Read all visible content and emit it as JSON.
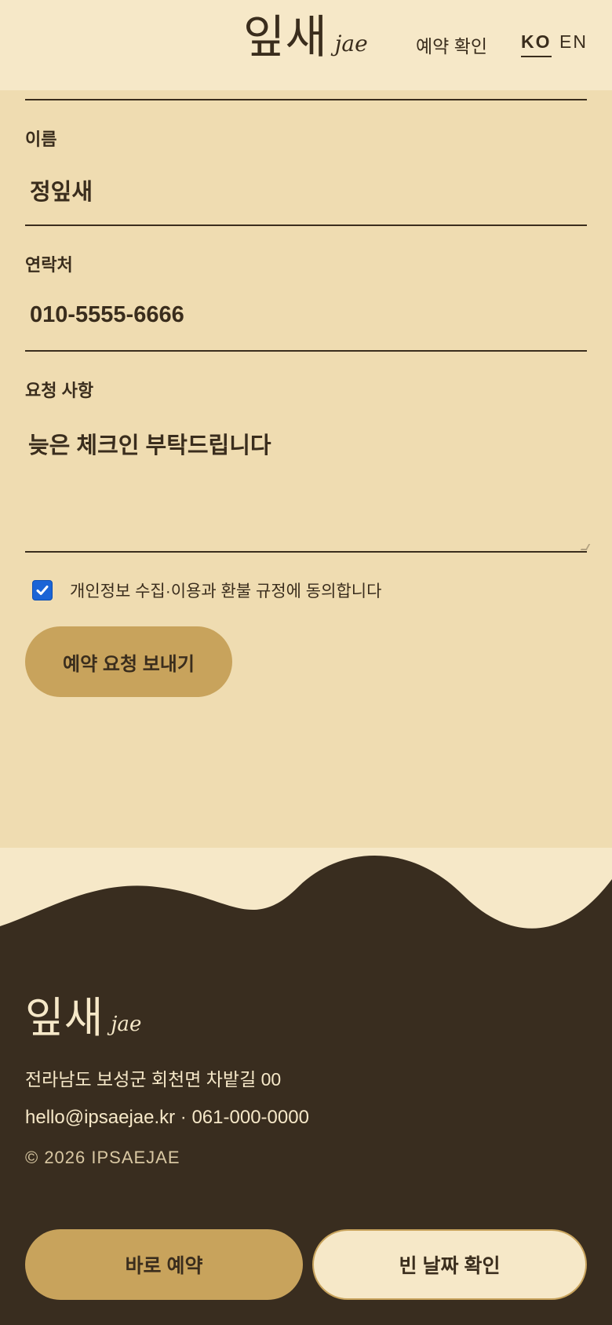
{
  "header": {
    "logo_main": "잎새",
    "logo_sub": "jae",
    "nav_confirm": "예약 확인",
    "lang_ko": "KO",
    "lang_en": "EN"
  },
  "form": {
    "name_label": "이름",
    "name_value": "정잎새",
    "phone_label": "연락처",
    "phone_value": "010-5555-6666",
    "request_label": "요청 사항",
    "request_value": "늦은 체크인 부탁드립니다",
    "agree_text": "개인정보 수집·이용과  환불 규정에 동의합니다",
    "agree_checked": true,
    "submit_label": "예약 요청 보내기"
  },
  "footer": {
    "logo_main": "잎새",
    "logo_sub": "jae",
    "address": "전라남도 보성군 회천면 차밭길 00",
    "contact": "hello@ipsaejae.kr · 061-000-0000",
    "copyright": "© 2026 IPSAEJAE",
    "book_label": "바로 예약",
    "dates_label": "빈 날짜 확인"
  },
  "colors": {
    "page_bg": "#efdcb1",
    "header_bg": "#f6e8c8",
    "footer_bg": "#392d1f",
    "accent": "#c8a35c",
    "text": "#3a2d1d",
    "checkbox": "#1a64d6"
  },
  "icons": {
    "checkbox_mark": "check-icon"
  }
}
